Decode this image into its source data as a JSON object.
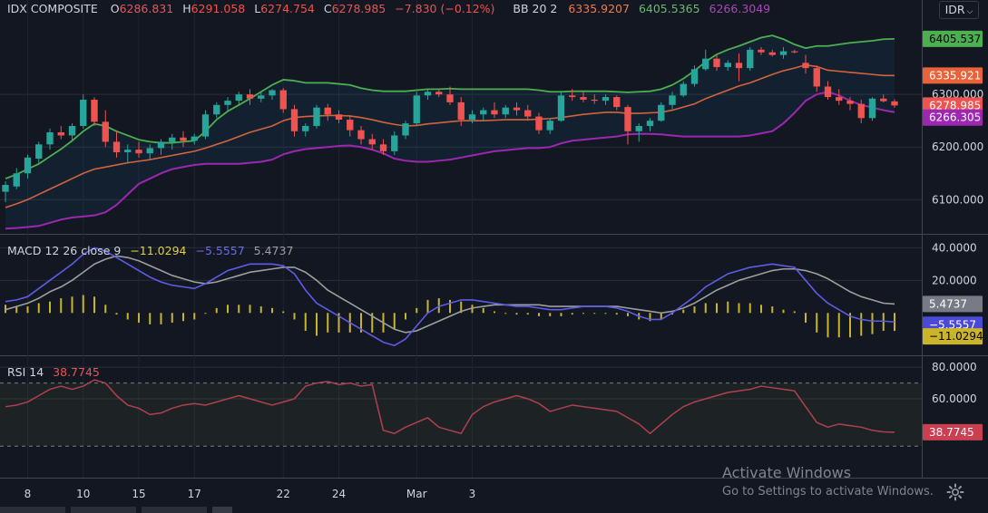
{
  "header": {
    "symbol": "IDX COMPOSITE",
    "ohlc": {
      "o_label": "O",
      "o": "6286.831",
      "h_label": "H",
      "h": "6291.058",
      "l_label": "L",
      "l": "6274.754",
      "c_label": "C",
      "c": "6278.985",
      "change": "−7.830 (−0.12%)"
    },
    "bb": {
      "label": "BB 20 2",
      "basis": "6335.9207",
      "upper": "6405.5365",
      "lower": "6266.3049"
    },
    "currency": "IDR",
    "currency_icon": "chevron-down-icon"
  },
  "macd_legend": {
    "label": "MACD 12 26 close 9",
    "hist": "−11.0294",
    "macd": "−5.5557",
    "signal": "5.4737"
  },
  "rsi_legend": {
    "label": "RSI 14",
    "value": "38.7745"
  },
  "watermark": {
    "line1": "Activate Windows",
    "line2": "Go to Settings to activate Windows."
  },
  "colors": {
    "bg": "#131722",
    "up": "#26a69a",
    "down": "#ef5350",
    "bb_upper": "#4caf50",
    "bb_basis": "#d2643c",
    "bb_lower": "#9c27b0",
    "macd": "#5c5ce6",
    "signal": "#9e9e9e",
    "hist": "#c9b42c",
    "rsi": "#b04050"
  },
  "chart_data": [
    {
      "type": "candlestick",
      "title": "IDX COMPOSITE",
      "ylim": [
        6035,
        6445
      ],
      "y_ticks": [
        "6100.000",
        "6200.000",
        "6300.000"
      ],
      "x_ticks": [
        "8",
        "10",
        "15",
        "17",
        "22",
        "24",
        "Mar",
        "3"
      ],
      "price_labels": {
        "upper": "6405.537",
        "basis": "6335.921",
        "last": "6278.985",
        "lower": "6266.305"
      },
      "candles": [
        [
          6115,
          6135,
          6095,
          6128
        ],
        [
          6125,
          6160,
          6120,
          6150
        ],
        [
          6150,
          6185,
          6140,
          6180
        ],
        [
          6178,
          6210,
          6170,
          6205
        ],
        [
          6205,
          6235,
          6195,
          6228
        ],
        [
          6228,
          6240,
          6215,
          6222
        ],
        [
          6222,
          6245,
          6210,
          6240
        ],
        [
          6240,
          6300,
          6235,
          6290
        ],
        [
          6290,
          6295,
          6240,
          6248
        ],
        [
          6248,
          6270,
          6200,
          6210
        ],
        [
          6210,
          6230,
          6180,
          6190
        ],
        [
          6190,
          6205,
          6170,
          6195
        ],
        [
          6195,
          6210,
          6180,
          6188
        ],
        [
          6188,
          6205,
          6175,
          6198
        ],
        [
          6198,
          6215,
          6185,
          6210
        ],
        [
          6210,
          6225,
          6195,
          6218
        ],
        [
          6218,
          6230,
          6200,
          6212
        ],
        [
          6212,
          6225,
          6205,
          6220
        ],
        [
          6220,
          6270,
          6215,
          6262
        ],
        [
          6262,
          6285,
          6255,
          6280
        ],
        [
          6280,
          6295,
          6270,
          6288
        ],
        [
          6288,
          6305,
          6280,
          6300
        ],
        [
          6300,
          6310,
          6280,
          6292
        ],
        [
          6292,
          6305,
          6285,
          6298
        ],
        [
          6298,
          6310,
          6290,
          6308
        ],
        [
          6308,
          6312,
          6265,
          6272
        ],
        [
          6272,
          6280,
          6220,
          6230
        ],
        [
          6230,
          6245,
          6220,
          6240
        ],
        [
          6240,
          6280,
          6235,
          6275
        ],
        [
          6275,
          6282,
          6250,
          6262
        ],
        [
          6262,
          6270,
          6245,
          6252
        ],
        [
          6252,
          6260,
          6220,
          6232
        ],
        [
          6232,
          6240,
          6205,
          6215
        ],
        [
          6215,
          6225,
          6195,
          6205
        ],
        [
          6205,
          6215,
          6185,
          6192
        ],
        [
          6192,
          6230,
          6185,
          6222
        ],
        [
          6222,
          6250,
          6215,
          6245
        ],
        [
          6245,
          6305,
          6240,
          6298
        ],
        [
          6298,
          6310,
          6290,
          6305
        ],
        [
          6305,
          6310,
          6295,
          6300
        ],
        [
          6300,
          6315,
          6280,
          6285
        ],
        [
          6285,
          6295,
          6240,
          6252
        ],
        [
          6252,
          6270,
          6245,
          6262
        ],
        [
          6262,
          6275,
          6250,
          6270
        ],
        [
          6270,
          6285,
          6255,
          6262
        ],
        [
          6262,
          6280,
          6255,
          6275
        ],
        [
          6275,
          6285,
          6260,
          6270
        ],
        [
          6270,
          6280,
          6250,
          6258
        ],
        [
          6258,
          6265,
          6225,
          6232
        ],
        [
          6232,
          6255,
          6225,
          6250
        ],
        [
          6250,
          6305,
          6248,
          6298
        ],
        [
          6298,
          6310,
          6288,
          6295
        ],
        [
          6295,
          6305,
          6285,
          6290
        ],
        [
          6290,
          6300,
          6282,
          6288
        ],
        [
          6288,
          6300,
          6280,
          6295
        ],
        [
          6295,
          6298,
          6270,
          6276
        ],
        [
          6276,
          6280,
          6205,
          6230
        ],
        [
          6230,
          6245,
          6210,
          6240
        ],
        [
          6240,
          6255,
          6230,
          6250
        ],
        [
          6250,
          6285,
          6248,
          6280
        ],
        [
          6280,
          6305,
          6272,
          6298
        ],
        [
          6298,
          6325,
          6295,
          6320
        ],
        [
          6320,
          6355,
          6315,
          6348
        ],
        [
          6348,
          6385,
          6345,
          6368
        ],
        [
          6368,
          6375,
          6345,
          6352
        ],
        [
          6352,
          6365,
          6345,
          6360
        ],
        [
          6360,
          6378,
          6325,
          6350
        ],
        [
          6350,
          6390,
          6345,
          6385
        ],
        [
          6385,
          6390,
          6375,
          6380
        ],
        [
          6380,
          6385,
          6372,
          6375
        ],
        [
          6375,
          6390,
          6368,
          6382
        ],
        [
          6382,
          6385,
          6378,
          6380
        ],
        [
          6360,
          6375,
          6340,
          6350
        ],
        [
          6350,
          6355,
          6305,
          6315
        ],
        [
          6315,
          6325,
          6290,
          6295
        ],
        [
          6295,
          6310,
          6280,
          6288
        ],
        [
          6288,
          6295,
          6270,
          6282
        ],
        [
          6282,
          6290,
          6245,
          6255
        ],
        [
          6255,
          6295,
          6250,
          6292
        ],
        [
          6292,
          6300,
          6285,
          6287
        ],
        [
          6286.831,
          6291.058,
          6274.754,
          6278.985
        ]
      ],
      "bb_upper": [
        6140,
        6148,
        6158,
        6168,
        6182,
        6196,
        6212,
        6230,
        6244,
        6240,
        6230,
        6222,
        6214,
        6210,
        6208,
        6208,
        6210,
        6212,
        6230,
        6252,
        6268,
        6280,
        6292,
        6305,
        6318,
        6328,
        6326,
        6322,
        6322,
        6322,
        6320,
        6318,
        6312,
        6308,
        6306,
        6306,
        6306,
        6308,
        6310,
        6310,
        6311,
        6310,
        6310,
        6310,
        6310,
        6310,
        6310,
        6310,
        6308,
        6305,
        6305,
        6306,
        6306,
        6306,
        6306,
        6305,
        6304,
        6305,
        6306,
        6310,
        6318,
        6330,
        6345,
        6362,
        6376,
        6385,
        6392,
        6400,
        6408,
        6412,
        6405,
        6395,
        6388,
        6392,
        6392,
        6395,
        6398,
        6400,
        6402,
        6405,
        6405.5365
      ],
      "bb_basis": [
        6085,
        6092,
        6100,
        6110,
        6120,
        6130,
        6140,
        6150,
        6158,
        6162,
        6166,
        6170,
        6173,
        6176,
        6180,
        6184,
        6188,
        6192,
        6198,
        6205,
        6212,
        6220,
        6228,
        6234,
        6240,
        6250,
        6256,
        6258,
        6259,
        6260,
        6260,
        6259,
        6256,
        6252,
        6247,
        6243,
        6240,
        6241,
        6244,
        6246,
        6248,
        6250,
        6250,
        6250,
        6251,
        6252,
        6252,
        6252,
        6253,
        6254,
        6256,
        6259,
        6262,
        6264,
        6266,
        6266,
        6264,
        6264,
        6265,
        6266,
        6270,
        6276,
        6282,
        6292,
        6300,
        6308,
        6316,
        6322,
        6330,
        6338,
        6345,
        6350,
        6356,
        6353,
        6346,
        6344,
        6342,
        6340,
        6338,
        6336,
        6335.9207
      ],
      "bb_lower": [
        6045,
        6046,
        6048,
        6050,
        6056,
        6062,
        6066,
        6068,
        6070,
        6076,
        6090,
        6110,
        6130,
        6140,
        6150,
        6158,
        6162,
        6166,
        6168,
        6168,
        6168,
        6168,
        6170,
        6172,
        6176,
        6186,
        6192,
        6196,
        6198,
        6200,
        6202,
        6203,
        6200,
        6195,
        6188,
        6178,
        6174,
        6172,
        6172,
        6174,
        6176,
        6180,
        6184,
        6188,
        6192,
        6194,
        6196,
        6198,
        6198,
        6200,
        6207,
        6212,
        6214,
        6216,
        6218,
        6220,
        6224,
        6225,
        6225,
        6224,
        6222,
        6220,
        6220,
        6220,
        6220,
        6220,
        6220,
        6222,
        6226,
        6230,
        6245,
        6265,
        6288,
        6300,
        6305,
        6298,
        6288,
        6280,
        6275,
        6270,
        6266.3049
      ]
    },
    {
      "type": "line+bar",
      "title": "MACD 12 26 close 9",
      "ylim": [
        -26,
        48
      ],
      "y_ticks": [
        "40.0000",
        "20.0000"
      ],
      "price_labels": {
        "signal": "5.4737",
        "macd": "−5.5557",
        "hist": "−11.0294"
      },
      "macd": [
        7,
        8,
        10,
        15,
        20,
        25,
        30,
        36,
        40,
        38,
        34,
        30,
        26,
        22,
        19,
        17,
        16,
        15,
        18,
        22,
        26,
        28,
        30,
        30,
        30,
        29,
        24,
        14,
        6,
        2,
        -2,
        -6,
        -10,
        -14,
        -18,
        -20,
        -16,
        -8,
        0,
        4,
        6,
        8,
        8,
        7,
        6,
        5,
        4,
        4,
        3,
        2,
        2,
        3,
        4,
        4,
        4,
        3,
        1,
        -2,
        -4,
        -4,
        0,
        5,
        10,
        16,
        20,
        24,
        26,
        28,
        29,
        30,
        29,
        28,
        20,
        12,
        6,
        2,
        -2,
        -4,
        -5,
        -5,
        -5.5557
      ],
      "signal": [
        2,
        4,
        6,
        9,
        13,
        16,
        20,
        25,
        30,
        33,
        35,
        34,
        32,
        29,
        26,
        23,
        21,
        19,
        18,
        19,
        21,
        23,
        25,
        26,
        27,
        28,
        28,
        25,
        20,
        14,
        10,
        6,
        2,
        -2,
        -6,
        -10,
        -12,
        -11,
        -8,
        -5,
        -2,
        1,
        3,
        4,
        5,
        5,
        5,
        5,
        5,
        4,
        4,
        4,
        4,
        4,
        4,
        4,
        3,
        2,
        1,
        0,
        1,
        3,
        6,
        10,
        14,
        17,
        20,
        22,
        24,
        26,
        27,
        27,
        26,
        24,
        21,
        17,
        13,
        10,
        8,
        6,
        5.4737
      ],
      "histogram": [
        5,
        4,
        4,
        6,
        7,
        9,
        10,
        11,
        10,
        5,
        -1,
        -4,
        -6,
        -7,
        -7,
        -6,
        -5,
        -4,
        0,
        3,
        5,
        5,
        5,
        4,
        3,
        1,
        -4,
        -11,
        -14,
        -12,
        -12,
        -12,
        -12,
        -12,
        -12,
        -10,
        -4,
        3,
        8,
        9,
        8,
        7,
        5,
        3,
        1,
        0,
        -1,
        -1,
        -2,
        -2,
        -2,
        -1,
        0,
        0,
        0,
        -1,
        -2,
        -4,
        -5,
        -4,
        -1,
        2,
        4,
        6,
        6,
        7,
        6,
        6,
        5,
        4,
        2,
        1,
        -6,
        -12,
        -15,
        -15,
        -15,
        -14,
        -13,
        -11,
        -11.0294
      ]
    },
    {
      "type": "line",
      "title": "RSI 14",
      "ylim": [
        10,
        87
      ],
      "y_ticks": [
        "80.0000",
        "60.0000"
      ],
      "band": [
        30,
        70
      ],
      "price_labels": {
        "value": "38.7745"
      },
      "rsi": [
        55,
        56,
        58,
        62,
        66,
        68,
        66,
        68,
        72,
        70,
        62,
        56,
        54,
        50,
        51,
        54,
        56,
        57,
        56,
        58,
        60,
        62,
        60,
        58,
        56,
        58,
        60,
        68,
        70,
        71,
        69,
        70,
        68,
        69,
        40,
        38,
        42,
        45,
        48,
        42,
        40,
        38,
        50,
        55,
        58,
        60,
        62,
        60,
        57,
        52,
        54,
        56,
        55,
        54,
        53,
        52,
        48,
        44,
        38,
        44,
        50,
        55,
        58,
        60,
        62,
        64,
        65,
        66,
        68,
        67,
        66,
        65,
        55,
        45,
        42,
        44,
        43,
        42,
        40,
        39,
        38.7745
      ]
    }
  ]
}
